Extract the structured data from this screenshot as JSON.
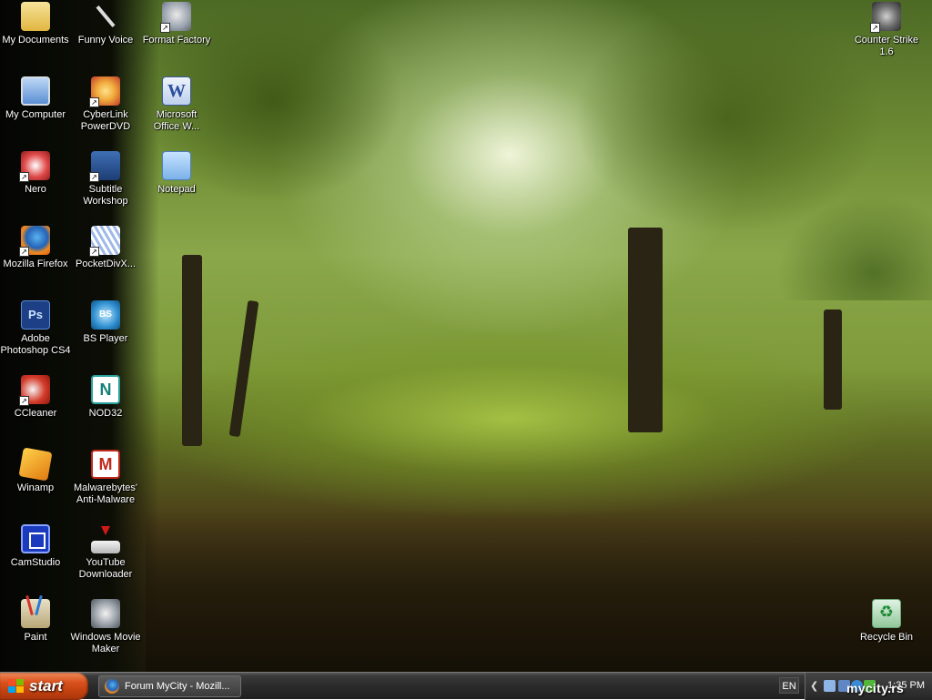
{
  "desktop": {
    "icons": [
      {
        "name": "desktop-icon-my-documents",
        "glyph": "folder-icon",
        "cls": "g-folder",
        "label": "My Documents",
        "shortcut": false
      },
      {
        "name": "desktop-icon-funny-voice",
        "glyph": "microphone-icon",
        "cls": "g-mic",
        "label": "Funny Voice",
        "shortcut": false
      },
      {
        "name": "desktop-icon-format-factory",
        "glyph": "format-factory-icon",
        "cls": "g-ff",
        "label": "Format Factory",
        "shortcut": true
      },
      {
        "name": "desktop-icon-my-computer",
        "glyph": "computer-icon",
        "cls": "g-computer",
        "label": "My Computer",
        "shortcut": false
      },
      {
        "name": "desktop-icon-cyberlink-powerdvd",
        "glyph": "powerdvd-icon",
        "cls": "g-dvd",
        "label": "CyberLink\nPowerDVD",
        "shortcut": true
      },
      {
        "name": "desktop-icon-microsoft-office-word",
        "glyph": "word-icon",
        "cls": "g-word",
        "label": "Microsoft\nOffice W...",
        "shortcut": true,
        "text": "W"
      },
      {
        "name": "desktop-icon-nero",
        "glyph": "nero-icon",
        "cls": "g-nero",
        "label": "Nero",
        "shortcut": true
      },
      {
        "name": "desktop-icon-subtitle-workshop",
        "glyph": "subtitle-workshop-icon",
        "cls": "g-subtitle",
        "label": "Subtitle\nWorkshop",
        "shortcut": true
      },
      {
        "name": "desktop-icon-notepad",
        "glyph": "notepad-icon",
        "cls": "g-notepad",
        "label": "Notepad",
        "shortcut": false
      },
      {
        "name": "desktop-icon-mozilla-firefox",
        "glyph": "firefox-icon",
        "cls": "g-firefox",
        "label": "Mozilla Firefox",
        "shortcut": true
      },
      {
        "name": "desktop-icon-pocketdivx",
        "glyph": "pocketdivx-icon",
        "cls": "g-pocketdivx",
        "label": "PocketDivX...",
        "shortcut": true
      },
      {
        "name": "desktop-icon-adobe-photoshop",
        "glyph": "photoshop-icon",
        "cls": "g-ps",
        "label": "Adobe\nPhotoshop CS4",
        "shortcut": true,
        "text": "Ps"
      },
      {
        "name": "desktop-icon-bs-player",
        "glyph": "bsplayer-icon",
        "cls": "g-bsplayer",
        "label": "BS Player",
        "shortcut": true,
        "text": "BS"
      },
      {
        "name": "desktop-icon-ccleaner",
        "glyph": "ccleaner-icon",
        "cls": "g-ccleaner",
        "label": "CCleaner",
        "shortcut": true
      },
      {
        "name": "desktop-icon-nod32",
        "glyph": "nod32-icon",
        "cls": "g-nod32",
        "label": "NOD32",
        "shortcut": true,
        "text": "N"
      },
      {
        "name": "desktop-icon-winamp",
        "glyph": "winamp-icon",
        "cls": "g-winamp",
        "label": "Winamp",
        "shortcut": true
      },
      {
        "name": "desktop-icon-malwarebytes",
        "glyph": "malwarebytes-icon",
        "cls": "g-mbam",
        "label": "Malwarebytes'\nAnti-Malware",
        "shortcut": true,
        "text": "M"
      },
      {
        "name": "desktop-icon-camstudio",
        "glyph": "camstudio-icon",
        "cls": "g-camstudio",
        "label": "CamStudio",
        "shortcut": false
      },
      {
        "name": "desktop-icon-youtube-downloader",
        "glyph": "youtube-downloader-icon",
        "cls": "g-ytdl",
        "label": "YouTube\nDownloader",
        "shortcut": true
      },
      {
        "name": "desktop-icon-paint",
        "glyph": "paint-icon",
        "cls": "g-paint",
        "label": "Paint",
        "shortcut": true
      },
      {
        "name": "desktop-icon-windows-movie-maker",
        "glyph": "movie-maker-icon",
        "cls": "g-wmm",
        "label": "Windows Movie\nMaker",
        "shortcut": false
      },
      {
        "name": "desktop-icon-counter-strike",
        "glyph": "counter-strike-icon",
        "cls": "g-cs",
        "label": "Counter Strike\n1.6",
        "shortcut": true
      },
      {
        "name": "desktop-icon-recycle-bin",
        "glyph": "recycle-bin-icon",
        "cls": "g-recycle",
        "label": "Recycle Bin",
        "shortcut": false
      }
    ]
  },
  "taskbar": {
    "start_label": "start",
    "tasks": [
      {
        "label": "Forum MyCity - Mozill..."
      }
    ],
    "language": "EN",
    "clock": "1:35 PM"
  },
  "watermark": "mycity.rs",
  "colors": {
    "start_button": "#d9521d",
    "taskbar": "#2b2b2b"
  }
}
